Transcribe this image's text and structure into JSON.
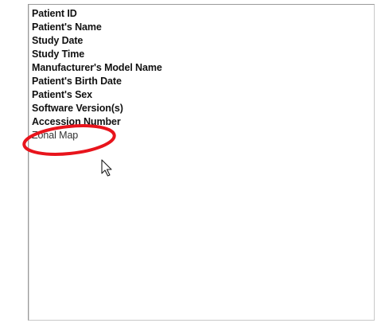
{
  "list": {
    "items": [
      {
        "label": "Patient ID",
        "style": "bold"
      },
      {
        "label": "Patient's Name",
        "style": "bold"
      },
      {
        "label": "Study Date",
        "style": "bold"
      },
      {
        "label": "Study Time",
        "style": "bold"
      },
      {
        "label": "Manufacturer's Model Name",
        "style": "bold"
      },
      {
        "label": "Patient's Birth Date",
        "style": "bold"
      },
      {
        "label": "Patient's Sex",
        "style": "bold"
      },
      {
        "label": "Software Version(s)",
        "style": "bold"
      },
      {
        "label": "Accession Number",
        "style": "bold"
      },
      {
        "label": "Zonal Map",
        "style": "plain"
      }
    ]
  },
  "annotation": {
    "color": "#e8141c",
    "target": "Zonal Map"
  },
  "cursor": {
    "icon": "arrow-cursor-icon"
  }
}
